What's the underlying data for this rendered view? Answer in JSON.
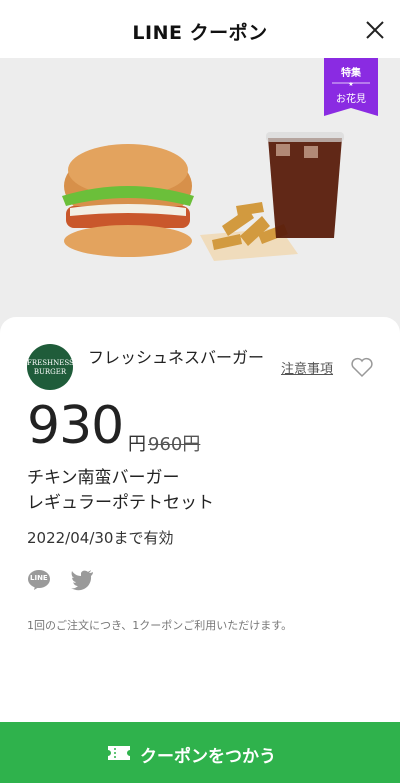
{
  "header": {
    "title": "LINE クーポン"
  },
  "badge": {
    "line1": "特集",
    "line2": "お花見",
    "color": "#8a2be2"
  },
  "shop": {
    "name": "フレッシュネスバーガー",
    "logo_text": "FRESHNESS BURGER"
  },
  "notice_label": "注意事項",
  "price": {
    "current": "930",
    "unit": "円",
    "original": "960円"
  },
  "product": {
    "line1": "チキン南蛮バーガー",
    "line2": "レギュラーポテトセット"
  },
  "validity": "2022/04/30まで有効",
  "share": {
    "line_label": "LINE"
  },
  "note": "1回のご注文につき、1クーポンご利用いただけます。",
  "cta": {
    "label": "クーポンをつかう",
    "color": "#2fb24c"
  }
}
